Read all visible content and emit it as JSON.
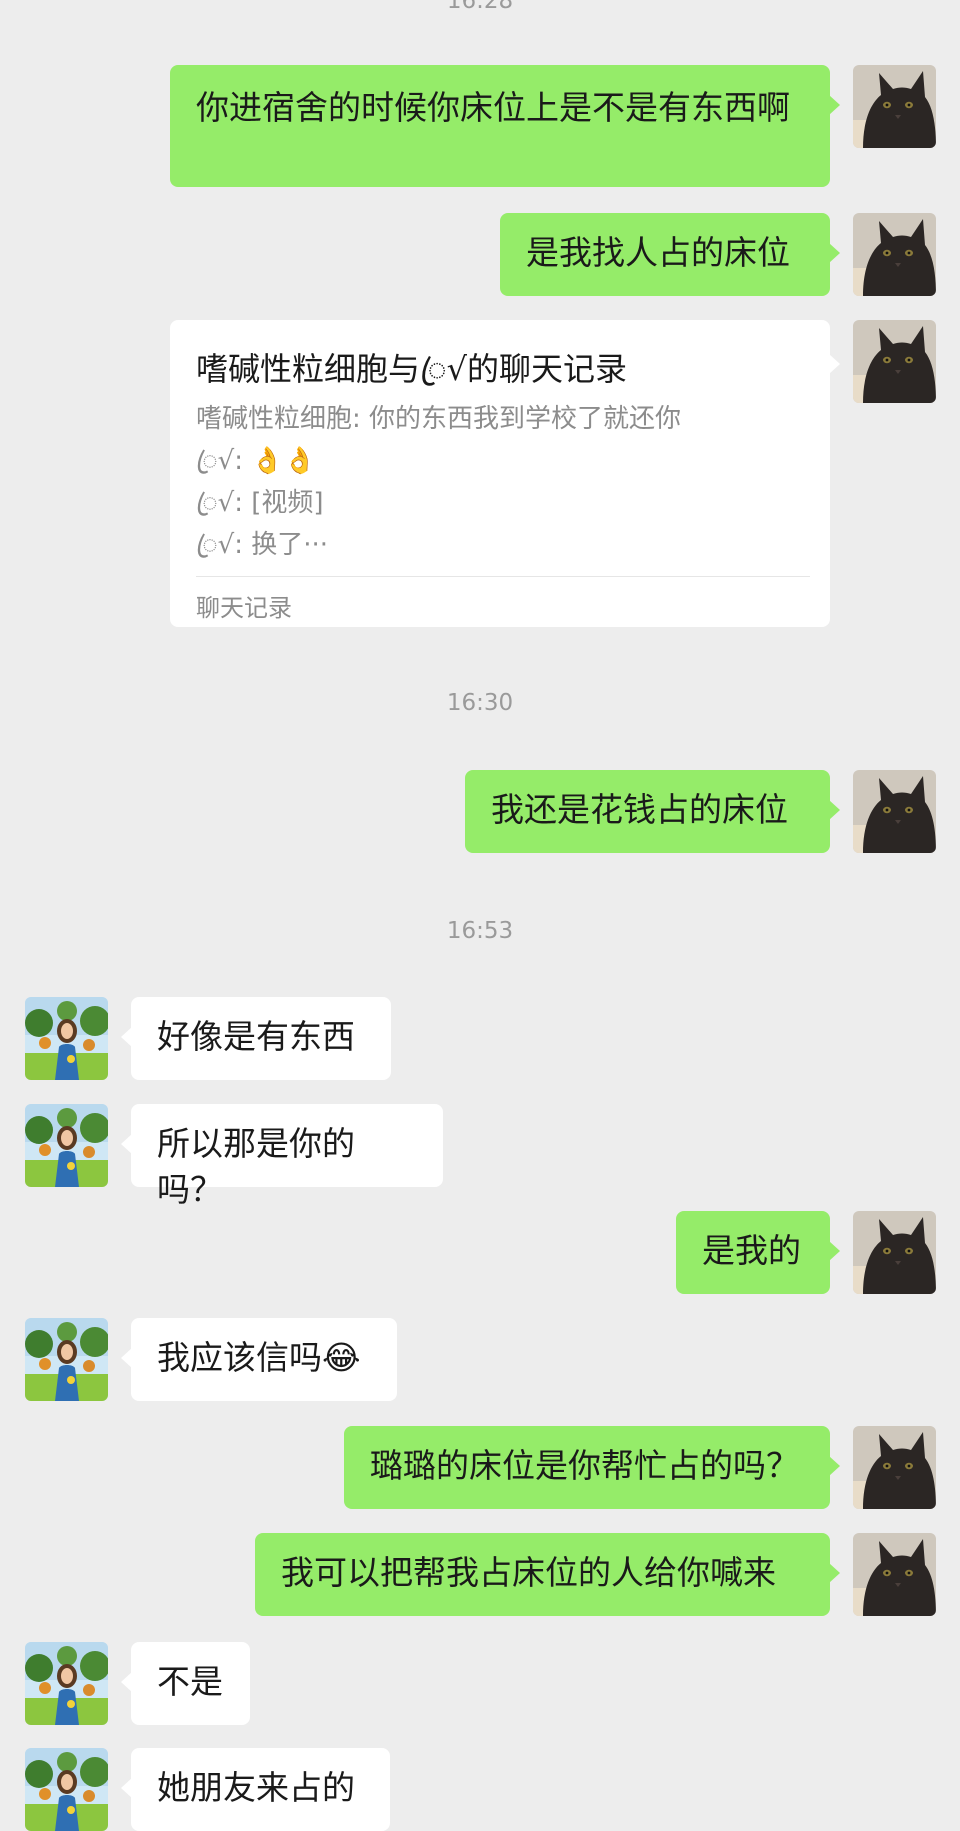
{
  "timestamps": {
    "t0": "16:28",
    "t1": "16:30",
    "t2": "16:53"
  },
  "messages": {
    "m1": "你进宿舍的时候你床位上是不是有东西啊",
    "m2": "是我找人占的床位",
    "m3": "我还是花钱占的床位",
    "m4": "好像是有东西",
    "m5": "所以那是你的吗？",
    "m6": "是我的",
    "m7": "我应该信吗😂",
    "m8": "璐璐的床位是你帮忙占的吗？",
    "m9": "我可以把帮我占床位的人给你喊来",
    "m10": "不是",
    "m11": "她朋友来占的"
  },
  "chat_record": {
    "title": "嗜碱性粒细胞与ꦿ√的聊天记录",
    "line1": "嗜碱性粒细胞: 你的东西我到学校了就还你",
    "line2": "ꦿ√: 👌👌",
    "line3": "ꦿ√: [视频]",
    "line4": "ꦿ√: 换了···",
    "footer": "聊天记录"
  },
  "colors": {
    "background": "#ededed",
    "sent_bubble": "#95ec69",
    "received_bubble": "#ffffff",
    "timestamp": "#9a9a9a"
  },
  "icons": {
    "self_avatar": "black-cat-avatar-icon",
    "contact_avatar": "girl-in-garden-avatar-icon"
  }
}
